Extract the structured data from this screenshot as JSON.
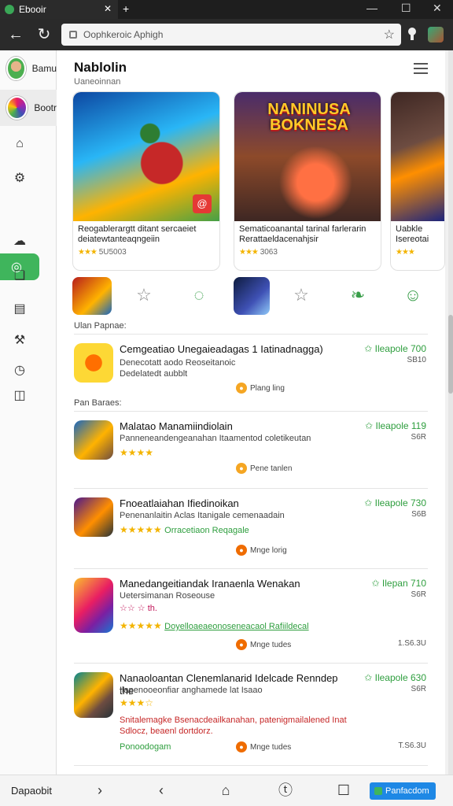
{
  "window": {
    "tab_title": "Ebooir",
    "tab_close": "✕",
    "new_tab": "+",
    "min": "—",
    "max": "☐",
    "close": "✕"
  },
  "addressbar": {
    "back": "←",
    "reload": "↻",
    "url": "Oophkeroic Aphigh",
    "star": "☆"
  },
  "sidebar": {
    "accounts": [
      {
        "name": "Bamu",
        "color": "#4caf50"
      },
      {
        "name": "Bootr",
        "color": "#9c27b0"
      }
    ],
    "icons": [
      "home-icon",
      "puzzle-icon",
      "active-icon",
      "cloud-icon",
      "bookmark-icon",
      "note-icon",
      "hammer-icon",
      "clock-icon",
      "chart-icon"
    ]
  },
  "header": {
    "title": "Nablolin",
    "subtitle": "Uaneoinnan"
  },
  "featured": [
    {
      "title": "Reogablerargtt ditant sercaeiet deiatewtanteaqngeiin",
      "rating_stars": "★★★",
      "rating_text": "5U5003",
      "badge": "@"
    },
    {
      "title": "Sematicoanantal tarinal farlerarin Rerattaeldacenahjsir",
      "rating_stars": "★★★",
      "rating_text": "3063",
      "badge": ""
    },
    {
      "title": "Uabkle Isereotai",
      "rating_stars": "★★★",
      "rating_text": "",
      "badge": ""
    }
  ],
  "featured_art": {
    "card2_logo_line1": "NANINUSA",
    "card2_logo_line2": "BOKNESA"
  },
  "sections": {
    "first": "Ulan Papnae:",
    "second": "Pan Baraes:"
  },
  "apps": [
    {
      "title": "Cemgeatiao Unegaieadagas 1 Iatinadnagga)",
      "desc1": "Denecotatt aodo Reoseitanoic",
      "desc2": "Dedelatedt aubblt",
      "stars": "",
      "tag": "",
      "price": "✩ Ileapole 700",
      "price_sub": "SB10",
      "chip": "Plang ling",
      "extra": ""
    },
    {
      "title": "Malatao Manamiindiolain",
      "desc1": "Panneneandengeanahan Itaamentod coletikeutan",
      "desc2": "",
      "stars": "★★★★",
      "tag": "",
      "price": "✩ Ileapole 119",
      "price_sub": "S6R",
      "chip": "Pene tanlen",
      "extra": ""
    },
    {
      "title": "Fnoeatlaiahan Ifiedinoikan",
      "desc1": "Penenanlaitin Aclas Itanigale cemenaadain",
      "desc2": "",
      "stars": "★★★★★",
      "tag": "Orracetiaon Reqagale",
      "price": "✩ Ileapole 730",
      "price_sub": "S6B",
      "chip": "Mnge lorig",
      "extra": ""
    },
    {
      "title": "Manedangeitiandak Iranaenla Wenakan",
      "desc1": "Uetersimanan Roseouse",
      "desc2": "☆☆ ☆ th.",
      "stars": "★★★★★",
      "tag": "Doyelloaeaeonoseneacaol Rafiildecal",
      "price": "✩ Ilepan 710",
      "price_sub": "S6R",
      "chip": "Mnge tudes",
      "extra": "1.S6.3U"
    },
    {
      "title": "Nanaoloantan Clenemlanarid Idelcade Renndep the",
      "desc1": "Ilapenooeonfiar anghamede lat Isaao",
      "desc2": "",
      "stars": "★★★☆",
      "tag": "Ponoodogam",
      "price": "✩ Ileapole 630",
      "price_sub": "S6R",
      "chip": "Mnge tudes",
      "extra": "T.S6.3U",
      "red": "Snitalemagke Bsenacdeailkanahan, patenigmailalened Inat Sdlocz, beaenl dortdorz."
    }
  ],
  "bottombar": {
    "label": "Dapaobit",
    "forward": "›",
    "back": "‹",
    "home": "⌂",
    "history": "ⓣ",
    "square": "☐",
    "button": "Panfacdom"
  }
}
